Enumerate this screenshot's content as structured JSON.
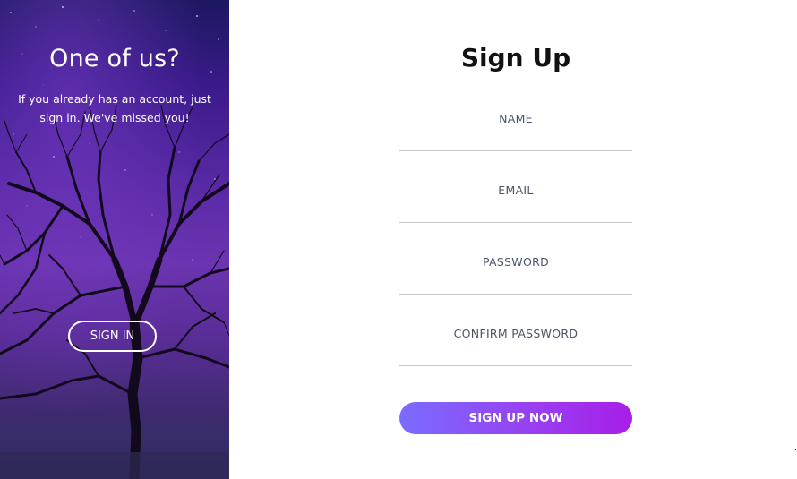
{
  "side_panel": {
    "title": "One of us?",
    "subtitle": "If you already has an account, just sign in. We've missed you!",
    "signin_label": "SIGN IN"
  },
  "form": {
    "title": "Sign Up",
    "fields": [
      {
        "label": "NAME",
        "value": ""
      },
      {
        "label": "EMAIL",
        "value": ""
      },
      {
        "label": "PASSWORD",
        "value": ""
      },
      {
        "label": "CONFIRM PASSWORD",
        "value": ""
      }
    ],
    "submit_label": "SIGN UP NOW"
  },
  "colors": {
    "accent_start": "#7a6cff",
    "accent_end": "#a61ee8",
    "panel_dark": "#2a2250",
    "panel_purple": "#6b34b0"
  },
  "corner_mark": "·"
}
